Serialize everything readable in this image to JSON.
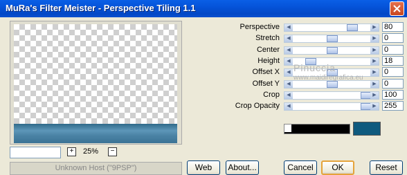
{
  "window": {
    "title": "MuRa's Filter Meister - Perspective Tiling 1.1"
  },
  "watermark": {
    "line1": "Pinuccia",
    "line2": "www.maidiregrafica.eu"
  },
  "preview": {
    "zoom": "25%",
    "status": "Unknown Host (\"9PSP\")"
  },
  "buttons": {
    "web": "Web",
    "about": "About...",
    "cancel": "Cancel",
    "ok": "OK",
    "reset": "Reset"
  },
  "controls": [
    {
      "label": "Perspective",
      "value": "80",
      "level": 0.8
    },
    {
      "label": "Stretch",
      "value": "0",
      "level": 0.5
    },
    {
      "label": "Center",
      "value": "0",
      "level": 0.5
    },
    {
      "label": "Height",
      "value": "18",
      "level": 0.18
    },
    {
      "label": "Offset X",
      "value": "0",
      "level": 0.5
    },
    {
      "label": "Offset Y",
      "value": "0",
      "level": 0.5
    },
    {
      "label": "Crop",
      "value": "100",
      "level": 1.0
    },
    {
      "label": "Crop Opacity",
      "value": "255",
      "level": 1.0
    }
  ],
  "colors": {
    "tile_color": "#0f5a7e"
  }
}
